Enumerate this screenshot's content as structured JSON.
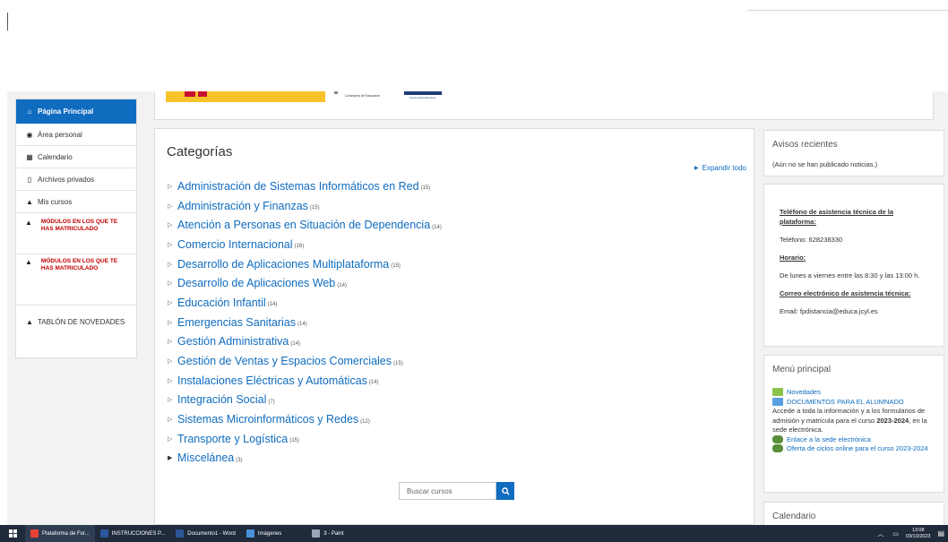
{
  "sidebar": {
    "home": "Página Principal",
    "items": [
      {
        "label": "Área personal",
        "icon": "dashboard-icon"
      },
      {
        "label": "Calendario",
        "icon": "calendar-icon"
      },
      {
        "label": "Archivos privados",
        "icon": "file-icon"
      },
      {
        "label": "Mis cursos",
        "icon": "graduation-cap-icon"
      }
    ],
    "modules1": "MÓDULOS EN LOS QUE TE HAS MATRICULADO",
    "modules2": "MÓDULOS EN LOS QUE TE HAS MATRICULADO",
    "tablon": "TABLÓN DE NOVEDADES"
  },
  "banner": {
    "consejeria": "Consejería de Educación",
    "fondo": "Fondo Social Europeo"
  },
  "main": {
    "title": "Categorías",
    "expand_all": "Expandir todo",
    "categories": [
      {
        "name": "Administración de Sistemas Informáticos en Red",
        "count": "(15)"
      },
      {
        "name": "Administración y Finanzas",
        "count": "(15)"
      },
      {
        "name": "Atención a Personas en Situación de Dependencia",
        "count": "(14)"
      },
      {
        "name": "Comercio Internacional",
        "count": "(16)"
      },
      {
        "name": "Desarrollo de Aplicaciones Multiplataforma",
        "count": "(15)"
      },
      {
        "name": "Desarrollo de Aplicaciones Web",
        "count": "(14)"
      },
      {
        "name": "Educación Infantil",
        "count": "(14)"
      },
      {
        "name": "Emergencias Sanitarias",
        "count": "(14)"
      },
      {
        "name": "Gestión Administrativa",
        "count": "(14)"
      },
      {
        "name": "Gestión de Ventas y Espacios Comerciales",
        "count": "(15)"
      },
      {
        "name": "Instalaciones Eléctricas y Automáticas",
        "count": "(14)"
      },
      {
        "name": "Integración Social",
        "count": "(7)"
      },
      {
        "name": "Sistemas Microinformáticos y Redes",
        "count": "(12)"
      },
      {
        "name": "Transporte y Logística",
        "count": "(15)"
      },
      {
        "name": "Miscelánea",
        "count": "(3)"
      }
    ],
    "search_placeholder": "Buscar cursos"
  },
  "news": {
    "title": "Avisos recientes",
    "text": "(Aún no se han publicado noticias.)"
  },
  "support": {
    "phone_heading": "Teléfono de asistencia técnica de la plataforma:",
    "phone": "Teléfono: 628238330",
    "hours_heading": "Horario:",
    "hours": "De lunes a viernes entre las 8:30 y las 13:00 h.",
    "email_heading": "Correo electrónico de asistencia técnica:",
    "email": "Email: fpdistancia@educa.jcyl.es"
  },
  "menu": {
    "title": "Menú principal",
    "novedades": "Novedades",
    "documentos": "DOCUMENTOS PARA EL ALUMNADO",
    "desc_pre": "Accede a toda la información y a los formularios de admisión y matrícula para el curso ",
    "desc_year": "2023-2024",
    "desc_post": ", en la sede electrónica.",
    "link_sede": "Enlace a la sede electrónica",
    "link_oferta": "Oferta de ciclos online para el curso 2023-2024"
  },
  "calendar": {
    "title": "Calendario"
  },
  "taskbar": {
    "items": [
      {
        "label": "Plataforma de For...",
        "color": "#e94235"
      },
      {
        "label": "INSTRUCCIONES P...",
        "color": "#2b579a"
      },
      {
        "label": "Documento1 - Word",
        "color": "#2b579a"
      },
      {
        "label": "Imágenes",
        "color": "#4a90d9"
      },
      {
        "label": "3 - Paint",
        "color": "#9aa5b8"
      }
    ],
    "time": "13:08",
    "date": "03/10/2023"
  },
  "colors": {
    "accent": "#0f6cbf",
    "module_red": "#c00000"
  }
}
